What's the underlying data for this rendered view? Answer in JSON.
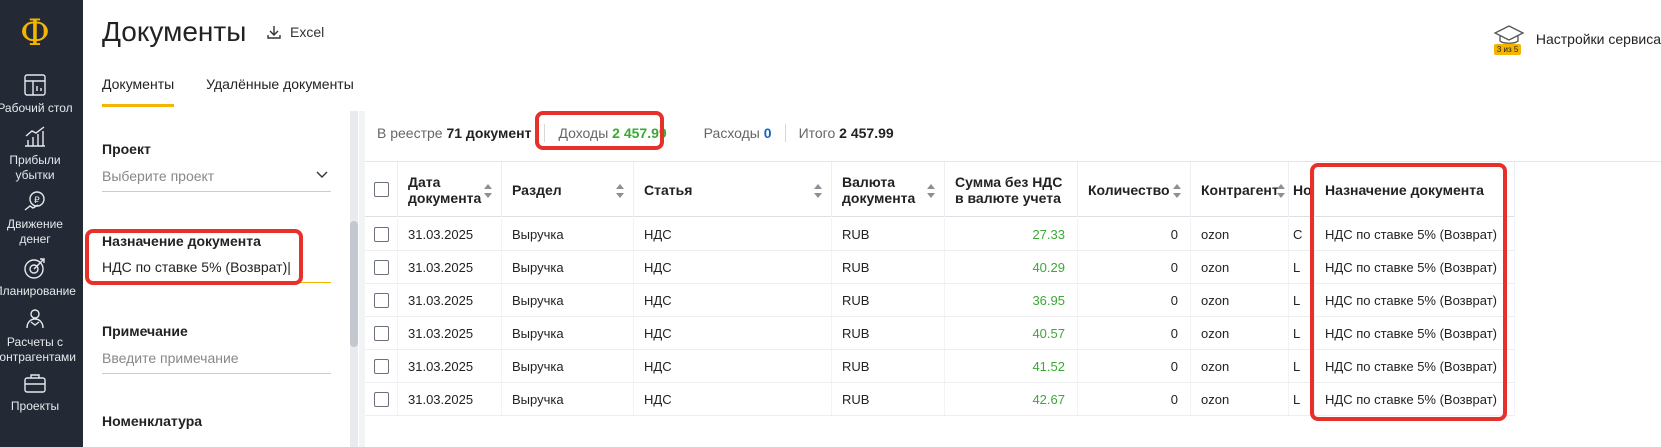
{
  "nav": {
    "logo": "Ф",
    "items": [
      {
        "label": "Рабочий стол",
        "icon": "dashboard-icon"
      },
      {
        "label": "Прибыли",
        "label2": "убытки",
        "icon": "profit-chart-icon"
      },
      {
        "label": "Движение",
        "label2": "денег",
        "icon": "money-flow-icon"
      },
      {
        "label": "Планирование",
        "icon": "planning-icon"
      },
      {
        "label": "Расчеты с",
        "label2": "контрагентами",
        "icon": "counterparties-icon"
      },
      {
        "label": "Проекты",
        "icon": "briefcase-icon"
      }
    ]
  },
  "header": {
    "title": "Документы",
    "excel_label": "Excel",
    "settings_label": "Настройки сервиса",
    "settings_badge": "3 из 5",
    "tabs": [
      {
        "label": "Документы",
        "active": true
      },
      {
        "label": "Удалённые документы",
        "active": false
      }
    ]
  },
  "filters": {
    "project_label": "Проект",
    "project_placeholder": "Выберите проект",
    "purpose_label": "Назначение документа",
    "purpose_value": "НДС по ставке 5% (Возврат)",
    "note_label": "Примечание",
    "note_placeholder": "Введите примечание",
    "nomenclature_label": "Номенклатура"
  },
  "summary": {
    "registry_label": "В реестре",
    "registry_count": "71 документ",
    "income_label": "Доходы",
    "income_value": "2 457.99",
    "expense_label": "Расходы",
    "expense_value": "0",
    "total_label": "Итого",
    "total_value": "2 457.99"
  },
  "table": {
    "columns": [
      "Дата документа",
      "Раздел",
      "Статья",
      "Валюта документа",
      "Сумма без НДС в валюте учета",
      "Количество",
      "Контрагент",
      "Но",
      "Назначение документа"
    ],
    "rows": [
      {
        "date": "31.03.2025",
        "section": "Выручка",
        "article": "НДС",
        "currency": "RUB",
        "amount": "27.33",
        "qty": "0",
        "counterparty": "ozon",
        "no": "C",
        "purpose": "НДС по ставке 5% (Возврат)"
      },
      {
        "date": "31.03.2025",
        "section": "Выручка",
        "article": "НДС",
        "currency": "RUB",
        "amount": "40.29",
        "qty": "0",
        "counterparty": "ozon",
        "no": "L",
        "purpose": "НДС по ставке 5% (Возврат)"
      },
      {
        "date": "31.03.2025",
        "section": "Выручка",
        "article": "НДС",
        "currency": "RUB",
        "amount": "36.95",
        "qty": "0",
        "counterparty": "ozon",
        "no": "L",
        "purpose": "НДС по ставке 5% (Возврат)"
      },
      {
        "date": "31.03.2025",
        "section": "Выручка",
        "article": "НДС",
        "currency": "RUB",
        "amount": "40.57",
        "qty": "0",
        "counterparty": "ozon",
        "no": "L",
        "purpose": "НДС по ставке 5% (Возврат)"
      },
      {
        "date": "31.03.2025",
        "section": "Выручка",
        "article": "НДС",
        "currency": "RUB",
        "amount": "41.52",
        "qty": "0",
        "counterparty": "ozon",
        "no": "L",
        "purpose": "НДС по ставке 5% (Возврат)"
      },
      {
        "date": "31.03.2025",
        "section": "Выручка",
        "article": "НДС",
        "currency": "RUB",
        "amount": "42.67",
        "qty": "0",
        "counterparty": "ozon",
        "no": "L",
        "purpose": "НДС по ставке 5% (Возврат)"
      }
    ]
  },
  "colors": {
    "accent": "#f5b400",
    "highlight": "#e8302a",
    "income": "#3aaa35",
    "expense": "#1565c0",
    "nav_bg": "#232a36"
  }
}
